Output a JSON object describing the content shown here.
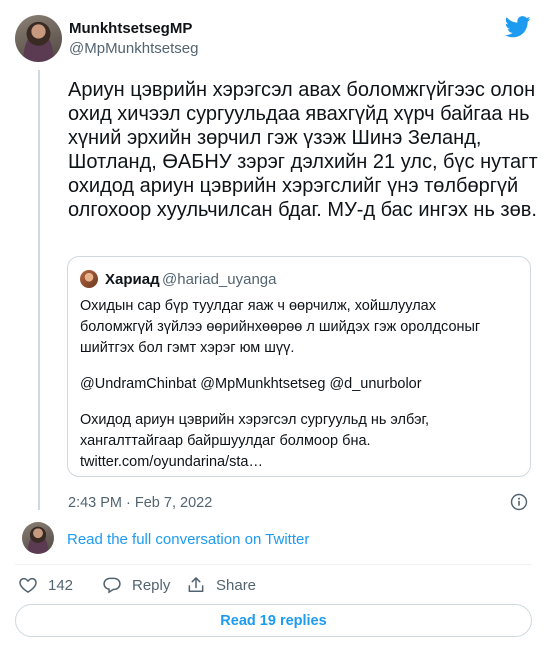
{
  "author": {
    "display_name": "MunkhtsetsegMP",
    "handle": "@MpMunkhtsetseg"
  },
  "tweet": {
    "text": "Ариун цэврийн хэрэгсэл авах боломжгүйгээс олон охид хичээл сургуульдаа явахгүйд хүрч байгаа нь хүний эрхийн зөрчил гэж үзэж Шинэ Зеланд, Шотланд, ӨАБНУ зэрэг дэлхийн 21 улс, бүс нутагт охидод ариун цэврийн хэрэгслийг үнэ төлбөргүй олгохоор хуульчилсан бдаг. МУ-д бас ингэх нь зөв.",
    "timestamp": "2:43 PM · Feb 7, 2022"
  },
  "quote": {
    "display_name": "Хариад",
    "handle": "@hariad_uyanga",
    "lines": [
      "Охидын сар бүр туулдаг яаж ч өөрчилж, хойшлуулах",
      "боломжгүй зүйлээ өөрийнхөөрөө л шийдэх гэж оролдсоныг",
      "шийтгэх бол гэмт хэрэг юм шүү.",
      "",
      "@UndramChinbat @MpMunkhtsetseg @d_unurbolor",
      "",
      "Охидод ариун цэврийн хэрэгсэл сургуульд нь элбэг,",
      "хангалттайгаар байршуулдаг болмоор бна.",
      "twitter.com/oyundarina/sta…"
    ]
  },
  "conversation_link": "Read the full conversation on Twitter",
  "actions": {
    "like_count": "142",
    "reply_label": "Reply",
    "share_label": "Share"
  },
  "read_replies_label": "Read 19 replies",
  "colors": {
    "accent": "#1d9bf0",
    "text": "#0f1419",
    "secondary_text": "#536471",
    "border": "#cfd9de"
  },
  "icons": [
    "twitter-bird-icon",
    "info-icon",
    "heart-icon",
    "reply-icon",
    "share-icon"
  ]
}
